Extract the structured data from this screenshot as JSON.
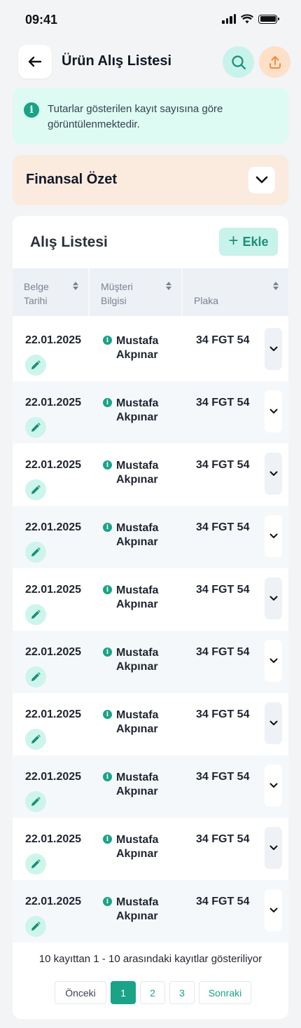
{
  "status_bar": {
    "time": "09:41"
  },
  "header": {
    "title": "Ürün Alış Listesi"
  },
  "info_banner": {
    "text": "Tutarlar gösterilen kayıt sayısına göre görüntülenmektedir."
  },
  "finance": {
    "title": "Finansal Özet"
  },
  "list": {
    "title": "Alış Listesi",
    "add_label": "Ekle",
    "columns": [
      "Belge Tarihi",
      "Müşteri Bilgisi",
      "Plaka"
    ],
    "rows": [
      {
        "date": "22.01.2025",
        "customer": "Mustafa Akpınar",
        "plate": "34 FGT 54"
      },
      {
        "date": "22.01.2025",
        "customer": "Mustafa Akpınar",
        "plate": "34 FGT 54"
      },
      {
        "date": "22.01.2025",
        "customer": "Mustafa Akpınar",
        "plate": "34 FGT 54"
      },
      {
        "date": "22.01.2025",
        "customer": "Mustafa Akpınar",
        "plate": "34 FGT 54"
      },
      {
        "date": "22.01.2025",
        "customer": "Mustafa Akpınar",
        "plate": "34 FGT 54"
      },
      {
        "date": "22.01.2025",
        "customer": "Mustafa Akpınar",
        "plate": "34 FGT 54"
      },
      {
        "date": "22.01.2025",
        "customer": "Mustafa Akpınar",
        "plate": "34 FGT 54"
      },
      {
        "date": "22.01.2025",
        "customer": "Mustafa Akpınar",
        "plate": "34 FGT 54"
      },
      {
        "date": "22.01.2025",
        "customer": "Mustafa Akpınar",
        "plate": "34 FGT 54"
      },
      {
        "date": "22.01.2025",
        "customer": "Mustafa Akpınar",
        "plate": "34 FGT 54"
      }
    ]
  },
  "pagination": {
    "summary": "10 kayıttan 1 - 10 arasındaki kayıtlar gösteriliyor",
    "prev": "Önceki",
    "pages": [
      "1",
      "2",
      "3"
    ],
    "current": "1",
    "next": "Sonraki"
  },
  "colors": {
    "accent": "#1aa386",
    "accent_light": "#c8f3ea",
    "info_bg": "#ddfaf3",
    "finance_bg": "#fbeade",
    "export_bg": "#fde0c8",
    "export_icon": "#f08a3c"
  },
  "icons": {
    "back": "arrow-left-icon",
    "search": "search-icon",
    "export": "upload-icon",
    "info": "info-icon",
    "toggle": "chevron-down-icon",
    "edit": "pencil-icon",
    "add": "plus-icon"
  }
}
